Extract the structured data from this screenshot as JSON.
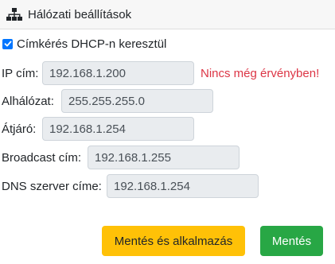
{
  "header": {
    "title": "Hálózati beállítások",
    "icon": "network-tree-icon"
  },
  "dhcp": {
    "label": "Címkérés DHCP-n keresztül",
    "checked": true
  },
  "fields": {
    "ip": {
      "label": "IP cím:",
      "value": "192.168.1.200"
    },
    "subnet": {
      "label": "Alhálózat:",
      "value": "255.255.255.0"
    },
    "gateway": {
      "label": "Átjáró:",
      "value": "192.168.1.254"
    },
    "broadcast": {
      "label": "Broadcast cím:",
      "value": "192.168.1.255"
    },
    "dns": {
      "label": "DNS szerver címe:",
      "value": "192.168.1.254"
    }
  },
  "warning": "Nincs még érvényben!",
  "buttons": {
    "save_apply": "Mentés és alkalmazás",
    "save": "Mentés"
  },
  "colors": {
    "warning_text": "#dc3545",
    "save_apply_bg": "#ffc107",
    "save_bg": "#28a745",
    "checkbox": "#0075ff"
  }
}
